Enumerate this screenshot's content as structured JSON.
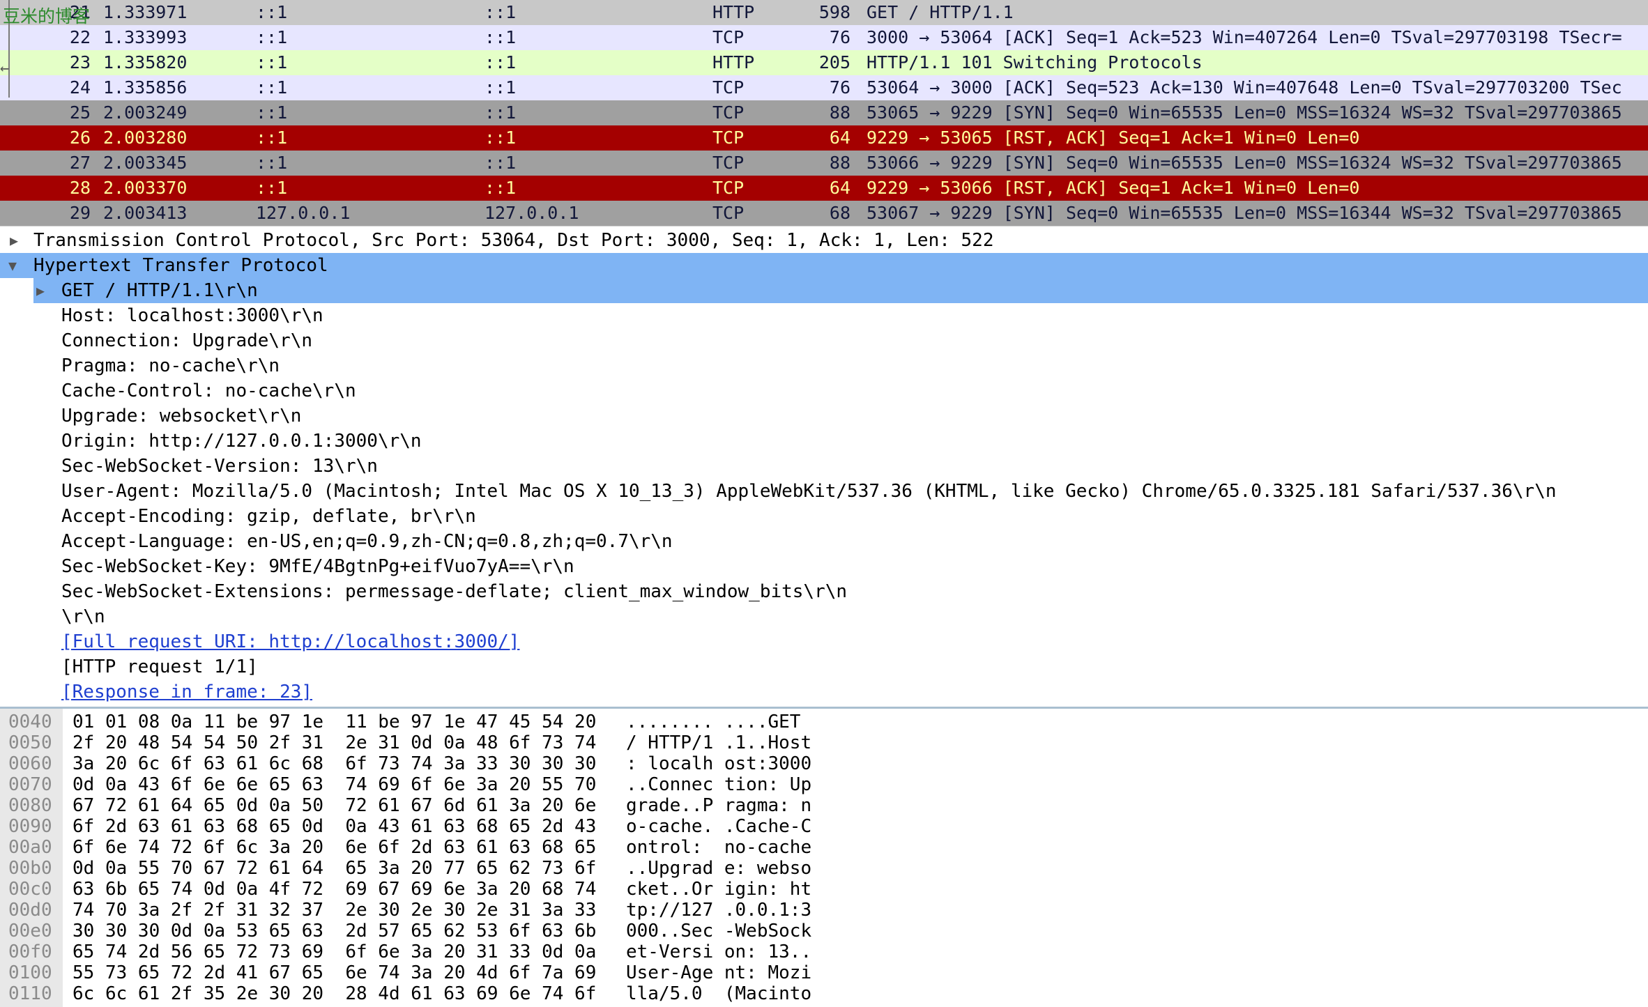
{
  "watermark": "豆米的博客",
  "packets": [
    {
      "no": "21",
      "time": "1.333971",
      "src": "::1",
      "dst": "::1",
      "proto": "HTTP",
      "len": "598",
      "info": "GET / HTTP/1.1",
      "style": "t-sel"
    },
    {
      "no": "22",
      "time": "1.333993",
      "src": "::1",
      "dst": "::1",
      "proto": "TCP",
      "len": "76",
      "info": "3000 → 53064 [ACK] Seq=1 Ack=523 Win=407264 Len=0 TSval=297703198 TSecr=",
      "style": "t-tcp"
    },
    {
      "no": "23",
      "time": "1.335820",
      "src": "::1",
      "dst": "::1",
      "proto": "HTTP",
      "len": "205",
      "info": "HTTP/1.1 101 Switching Protocols",
      "style": "t-http"
    },
    {
      "no": "24",
      "time": "1.335856",
      "src": "::1",
      "dst": "::1",
      "proto": "TCP",
      "len": "76",
      "info": "53064 → 3000 [ACK] Seq=523 Ack=130 Win=407648 Len=0 TSval=297703200 TSec",
      "style": "t-tcp"
    },
    {
      "no": "25",
      "time": "2.003249",
      "src": "::1",
      "dst": "::1",
      "proto": "TCP",
      "len": "88",
      "info": "53065 → 9229 [SYN] Seq=0 Win=65535 Len=0 MSS=16324 WS=32 TSval=297703865",
      "style": "t-gray"
    },
    {
      "no": "26",
      "time": "2.003280",
      "src": "::1",
      "dst": "::1",
      "proto": "TCP",
      "len": "64",
      "info": "9229 → 53065 [RST, ACK] Seq=1 Ack=1 Win=0 Len=0",
      "style": "t-rst"
    },
    {
      "no": "27",
      "time": "2.003345",
      "src": "::1",
      "dst": "::1",
      "proto": "TCP",
      "len": "88",
      "info": "53066 → 9229 [SYN] Seq=0 Win=65535 Len=0 MSS=16324 WS=32 TSval=297703865",
      "style": "t-gray"
    },
    {
      "no": "28",
      "time": "2.003370",
      "src": "::1",
      "dst": "::1",
      "proto": "TCP",
      "len": "64",
      "info": "9229 → 53066 [RST, ACK] Seq=1 Ack=1 Win=0 Len=0",
      "style": "t-rst"
    },
    {
      "no": "29",
      "time": "2.003413",
      "src": "127.0.0.1",
      "dst": "127.0.0.1",
      "proto": "TCP",
      "len": "68",
      "info": "53067 → 9229 [SYN] Seq=0 Win=65535 Len=0 MSS=16344 WS=32 TSval=297703865",
      "style": "t-gray"
    }
  ],
  "details": {
    "tcp_summary": "Transmission Control Protocol, Src Port: 53064, Dst Port: 3000, Seq: 1, Ack: 1, Len: 522",
    "http_header": "Hypertext Transfer Protocol",
    "request_line": "GET / HTTP/1.1\\r\\n",
    "headers": [
      "Host: localhost:3000\\r\\n",
      "Connection: Upgrade\\r\\n",
      "Pragma: no-cache\\r\\n",
      "Cache-Control: no-cache\\r\\n",
      "Upgrade: websocket\\r\\n",
      "Origin: http://127.0.0.1:3000\\r\\n",
      "Sec-WebSocket-Version: 13\\r\\n",
      "User-Agent: Mozilla/5.0 (Macintosh; Intel Mac OS X 10_13_3) AppleWebKit/537.36 (KHTML, like Gecko) Chrome/65.0.3325.181 Safari/537.36\\r\\n",
      "Accept-Encoding: gzip, deflate, br\\r\\n",
      "Accept-Language: en-US,en;q=0.9,zh-CN;q=0.8,zh;q=0.7\\r\\n",
      "Sec-WebSocket-Key: 9MfE/4BgtnPg+eifVuo7yA==\\r\\n",
      "Sec-WebSocket-Extensions: permessage-deflate; client_max_window_bits\\r\\n",
      "\\r\\n"
    ],
    "full_uri": "[Full request URI: http://localhost:3000/]",
    "request_count": "[HTTP request 1/1]",
    "response_frame": "[Response in frame: 23]"
  },
  "hex_rows": [
    {
      "off": "0040",
      "hex": "01 01 08 0a 11 be 97 1e  11 be 97 1e 47 45 54 20",
      "ascii": "........ ....GET "
    },
    {
      "off": "0050",
      "hex": "2f 20 48 54 54 50 2f 31  2e 31 0d 0a 48 6f 73 74",
      "ascii": "/ HTTP/1 .1..Host"
    },
    {
      "off": "0060",
      "hex": "3a 20 6c 6f 63 61 6c 68  6f 73 74 3a 33 30 30 30",
      "ascii": ": localh ost:3000"
    },
    {
      "off": "0070",
      "hex": "0d 0a 43 6f 6e 6e 65 63  74 69 6f 6e 3a 20 55 70",
      "ascii": "..Connec tion: Up"
    },
    {
      "off": "0080",
      "hex": "67 72 61 64 65 0d 0a 50  72 61 67 6d 61 3a 20 6e",
      "ascii": "grade..P ragma: n"
    },
    {
      "off": "0090",
      "hex": "6f 2d 63 61 63 68 65 0d  0a 43 61 63 68 65 2d 43",
      "ascii": "o-cache. .Cache-C"
    },
    {
      "off": "00a0",
      "hex": "6f 6e 74 72 6f 6c 3a 20  6e 6f 2d 63 61 63 68 65",
      "ascii": "ontrol:  no-cache"
    },
    {
      "off": "00b0",
      "hex": "0d 0a 55 70 67 72 61 64  65 3a 20 77 65 62 73 6f",
      "ascii": "..Upgrad e: webso"
    },
    {
      "off": "00c0",
      "hex": "63 6b 65 74 0d 0a 4f 72  69 67 69 6e 3a 20 68 74",
      "ascii": "cket..Or igin: ht"
    },
    {
      "off": "00d0",
      "hex": "74 70 3a 2f 2f 31 32 37  2e 30 2e 30 2e 31 3a 33",
      "ascii": "tp://127 .0.0.1:3"
    },
    {
      "off": "00e0",
      "hex": "30 30 30 0d 0a 53 65 63  2d 57 65 62 53 6f 63 6b",
      "ascii": "000..Sec -WebSock"
    },
    {
      "off": "00f0",
      "hex": "65 74 2d 56 65 72 73 69  6f 6e 3a 20 31 33 0d 0a",
      "ascii": "et-Versi on: 13.."
    },
    {
      "off": "0100",
      "hex": "55 73 65 72 2d 41 67 65  6e 74 3a 20 4d 6f 7a 69",
      "ascii": "User-Age nt: Mozi"
    },
    {
      "off": "0110",
      "hex": "6c 6c 61 2f 35 2e 30 20  28 4d 61 63 69 6e 74 6f",
      "ascii": "lla/5.0  (Macinto"
    }
  ]
}
